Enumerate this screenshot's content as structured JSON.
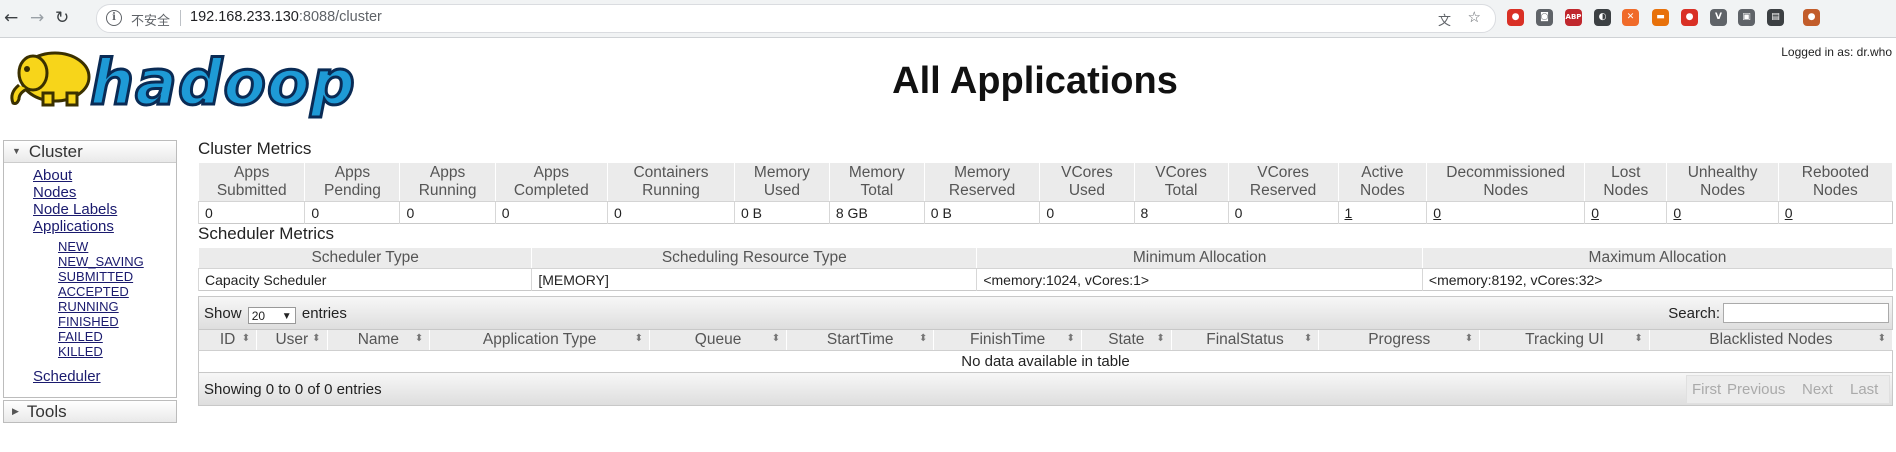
{
  "browser": {
    "security_label": "不安全",
    "url_host": "192.168.233.130",
    "url_rest": ":8088/cluster",
    "extensions": [
      {
        "name": "ext-red-icon",
        "color": "#d93025",
        "glyph": "●"
      },
      {
        "name": "ext-gray-icon",
        "color": "#5f6368",
        "glyph": "◙"
      },
      {
        "name": "adblock-plus-icon",
        "color": "#c0272d",
        "glyph": "ABP"
      },
      {
        "name": "ext-circle-icon",
        "color": "#3c4043",
        "glyph": "◐"
      },
      {
        "name": "ext-orange-icon",
        "color": "#f06b2a",
        "glyph": "✕"
      },
      {
        "name": "ext-orange-bar-icon",
        "color": "#e8710a",
        "glyph": "▬"
      },
      {
        "name": "location-pin-icon",
        "color": "#d93025",
        "glyph": "●"
      },
      {
        "name": "ext-v-icon",
        "color": "#5f6368",
        "glyph": "V"
      },
      {
        "name": "ext-box-icon",
        "color": "#5f6368",
        "glyph": "▣"
      },
      {
        "name": "ext-doc-icon",
        "color": "#3c4043",
        "glyph": "▤"
      },
      {
        "name": "profile-avatar-icon",
        "color": "#c25c2a",
        "glyph": "●"
      }
    ]
  },
  "header": {
    "logo_text": "hadoop",
    "title": "All Applications",
    "logged_in": "Logged in as: dr.who"
  },
  "sidebar": {
    "cluster_label": "Cluster",
    "cluster_links": [
      "About",
      "Nodes",
      "Node Labels",
      "Applications"
    ],
    "app_states": [
      "NEW",
      "NEW_SAVING",
      "SUBMITTED",
      "ACCEPTED",
      "RUNNING",
      "FINISHED",
      "FAILED",
      "KILLED"
    ],
    "scheduler_label": "Scheduler",
    "tools_label": "Tools"
  },
  "cluster_metrics": {
    "title": "Cluster Metrics",
    "headers": [
      [
        "Apps",
        "Submitted"
      ],
      [
        "Apps",
        "Pending"
      ],
      [
        "Apps",
        "Running"
      ],
      [
        "Apps",
        "Completed"
      ],
      [
        "Containers",
        "Running"
      ],
      [
        "Memory",
        "Used"
      ],
      [
        "Memory",
        "Total"
      ],
      [
        "Memory",
        "Reserved"
      ],
      [
        "VCores",
        "Used"
      ],
      [
        "VCores",
        "Total"
      ],
      [
        "VCores",
        "Reserved"
      ],
      [
        "Active",
        "Nodes"
      ],
      [
        "Decommissioned",
        "Nodes"
      ],
      [
        "Lost",
        "Nodes"
      ],
      [
        "Unhealthy",
        "Nodes"
      ],
      [
        "Rebooted",
        "Nodes"
      ]
    ],
    "values": [
      "0",
      "0",
      "0",
      "0",
      "0",
      "0 B",
      "8 GB",
      "0 B",
      "0",
      "8",
      "0",
      "1",
      "0",
      "0",
      "0",
      "0"
    ],
    "linked": [
      false,
      false,
      false,
      false,
      false,
      false,
      false,
      false,
      false,
      false,
      false,
      true,
      true,
      true,
      true,
      true
    ]
  },
  "scheduler_metrics": {
    "title": "Scheduler Metrics",
    "headers": [
      "Scheduler Type",
      "Scheduling Resource Type",
      "Minimum Allocation",
      "Maximum Allocation"
    ],
    "values": [
      "Capacity Scheduler",
      "[MEMORY]",
      "<memory:1024, vCores:1>",
      "<memory:8192, vCores:32>"
    ]
  },
  "apps_table": {
    "show_label": "Show",
    "page_size": "20",
    "entries_label": "entries",
    "search_label": "Search:",
    "columns": [
      "ID",
      "User",
      "Name",
      "Application Type",
      "Queue",
      "StartTime",
      "FinishTime",
      "State",
      "FinalStatus",
      "Progress",
      "Tracking UI",
      "Blacklisted Nodes"
    ],
    "empty_message": "No data available in table",
    "info": "Showing 0 to 0 of 0 entries",
    "pager": [
      "First",
      "Previous",
      "Next",
      "Last"
    ]
  }
}
